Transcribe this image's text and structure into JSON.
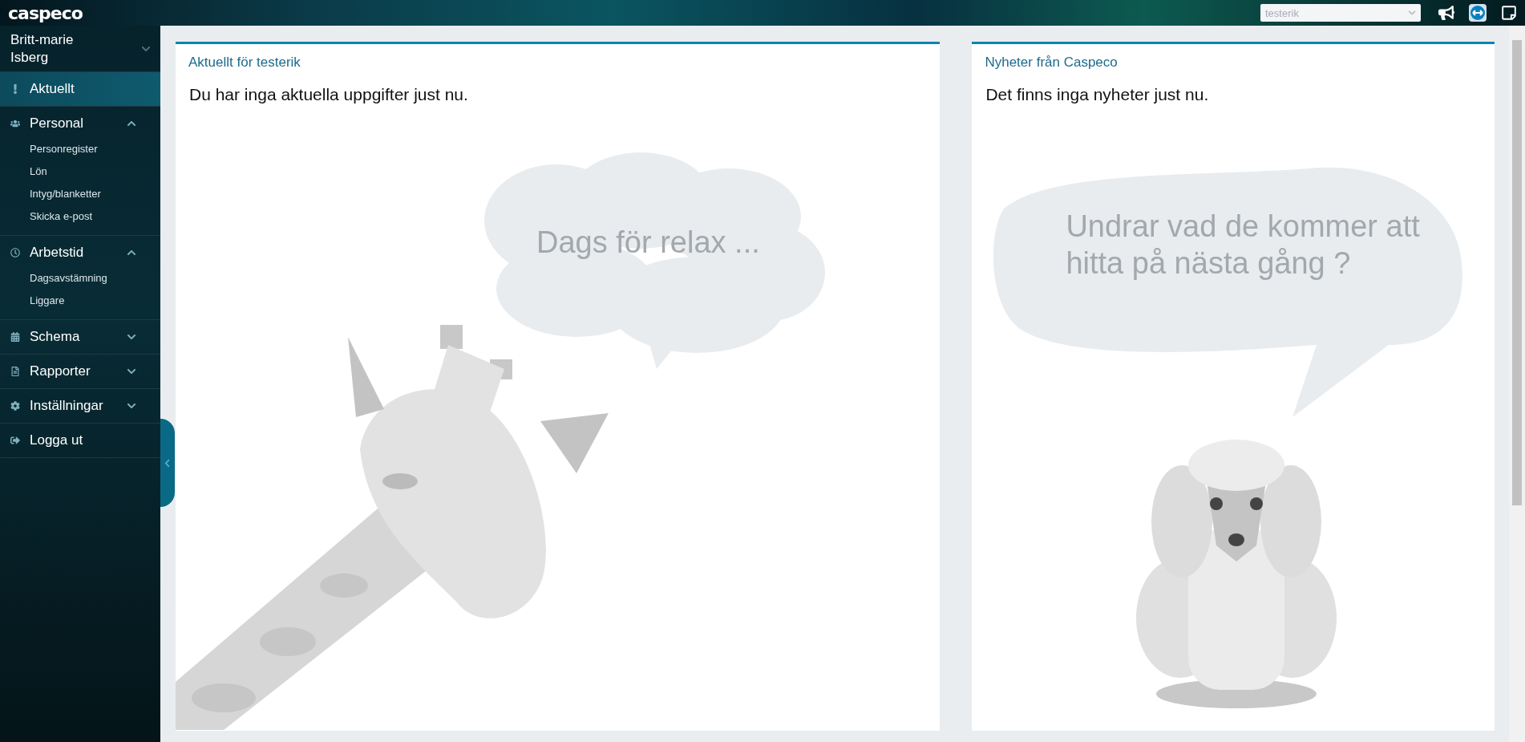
{
  "topbar": {
    "logo": "caspeco",
    "company_select": {
      "value": "testerik"
    }
  },
  "sidebar": {
    "user": "Britt-marie Isberg",
    "items": [
      {
        "kind": "link",
        "label": "Aktuellt",
        "selected": true
      },
      {
        "kind": "group",
        "label": "Personal",
        "expanded": true,
        "children": [
          {
            "label": "Personregister"
          },
          {
            "label": "Lön"
          },
          {
            "label": "Intyg/blanketter"
          },
          {
            "label": "Skicka e-post"
          }
        ]
      },
      {
        "kind": "group",
        "label": "Arbetstid",
        "expanded": true,
        "children": [
          {
            "label": "Dagsavstämning"
          },
          {
            "label": "Liggare"
          }
        ]
      },
      {
        "kind": "group",
        "label": "Schema",
        "expanded": false
      },
      {
        "kind": "group",
        "label": "Rapporter",
        "expanded": false
      },
      {
        "kind": "group",
        "label": "Inställningar",
        "expanded": false
      },
      {
        "kind": "link",
        "label": "Logga ut",
        "selected": false
      }
    ]
  },
  "panels": [
    {
      "title": "Aktuellt för testerik",
      "message": "Du har inga aktuella uppgifter just nu.",
      "illustration": {
        "kind": "giraffe",
        "bubble": "Dags för relax ..."
      }
    },
    {
      "title": "Nyheter från Caspeco",
      "message": "Det finns inga nyheter just nu.",
      "illustration": {
        "kind": "poodle",
        "bubble": "Undrar vad de kommer att hitta på nästa gång ?"
      }
    }
  ]
}
